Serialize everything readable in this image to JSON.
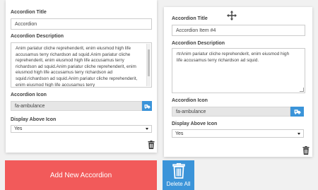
{
  "accordions": [
    {
      "title_label": "Accordion Title",
      "title_value": "Accordion",
      "description_label": "Accordion Description",
      "description_value": "Anim pariatur cliche reprehenderit, enim eiusmod high life accusamus terry richardson ad squid.Anim pariatur cliche reprehenderit, enim eiusmod high life accusamus terry richardson ad squid.Anim pariatur cliche reprehenderit, enim eiusmod high life accusamus terry richardson ad squid.richardson ad squid.Anim pariatur cliche reprehenderit, enim eiusmod high life accusamus terry",
      "icon_label": "Accordion Icon",
      "icon_value": "fa-ambulance",
      "display_label": "Display Above Icon",
      "display_value": "Yes"
    },
    {
      "title_label": "Accordion Title",
      "title_value": "Accordion Item #4",
      "description_label": "Accordion Description",
      "description_value": "rtrAnim pariatur cliche reprehenderit, enim eiusmod high life accusamus terry richardson ad squid.",
      "icon_label": "Accordion Icon",
      "icon_value": "fa-ambulance",
      "display_label": "Display Above Icon",
      "display_value": "Yes"
    }
  ],
  "actions": {
    "add_label": "Add New Accordion",
    "delete_all_label": "Delete All"
  },
  "icons": {
    "icon_picker": "ambulance-icon",
    "remove": "trash-icon",
    "drag": "move-icon"
  },
  "colors": {
    "add_button": "#f25a5a",
    "primary_button": "#3b94d9",
    "icon_field_bg": "#e6e6e6"
  }
}
